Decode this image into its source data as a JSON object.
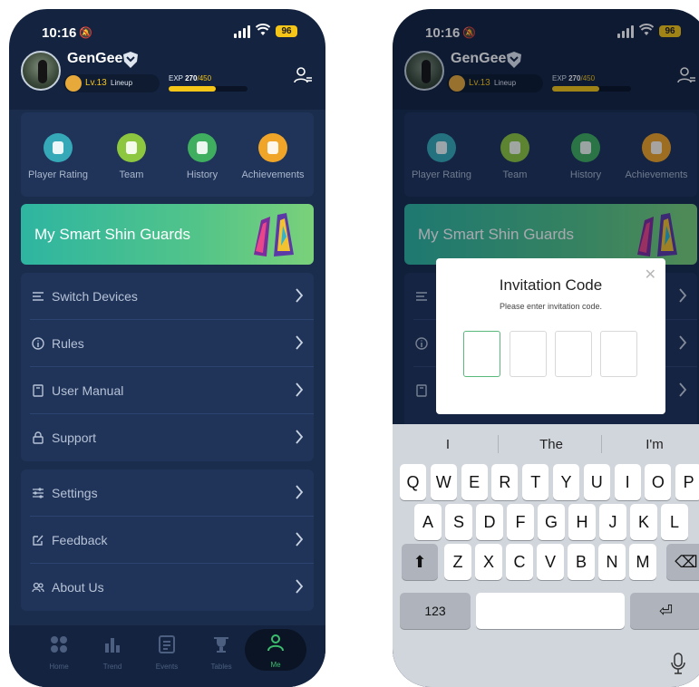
{
  "status": {
    "time": "10:16",
    "battery": "96"
  },
  "profile": {
    "username": "GenGee",
    "level": "Lv.13",
    "level_tag": "Lineup",
    "exp_label": "EXP",
    "exp_current": "270",
    "exp_max": "/450",
    "exp_fraction": 0.6
  },
  "quick_actions": [
    {
      "label": "Player Rating",
      "color": "#36a9b8"
    },
    {
      "label": "Team",
      "color": "#8dc63f"
    },
    {
      "label": "History",
      "color": "#3fae5f"
    },
    {
      "label": "Achievements",
      "color": "#f0a528"
    }
  ],
  "banner": {
    "title": "My Smart Shin Guards"
  },
  "menu_group_1": [
    {
      "label": "Switch Devices",
      "icon": "switch-icon"
    },
    {
      "label": "Rules",
      "icon": "info-icon"
    },
    {
      "label": "User Manual",
      "icon": "manual-icon"
    },
    {
      "label": "Support",
      "icon": "lock-icon"
    }
  ],
  "menu_group_2": [
    {
      "label": "Settings",
      "icon": "sliders-icon"
    },
    {
      "label": "Feedback",
      "icon": "edit-icon"
    },
    {
      "label": "About Us",
      "icon": "people-icon"
    }
  ],
  "tabs": [
    {
      "label": "Home"
    },
    {
      "label": "Trend"
    },
    {
      "label": "Events"
    },
    {
      "label": "Tables"
    },
    {
      "label": "Me",
      "active": true
    }
  ],
  "dialog": {
    "title": "Invitation Code",
    "subtitle": "Please enter invitation code.",
    "close": "✕",
    "code_length": 4
  },
  "keyboard": {
    "suggestions": [
      "I",
      "The",
      "I'm"
    ],
    "row1": [
      "Q",
      "W",
      "E",
      "R",
      "T",
      "Y",
      "U",
      "I",
      "O",
      "P"
    ],
    "row2": [
      "A",
      "S",
      "D",
      "F",
      "G",
      "H",
      "J",
      "K",
      "L"
    ],
    "row3": [
      "Z",
      "X",
      "C",
      "V",
      "B",
      "N",
      "M"
    ],
    "numbers_key": "123",
    "return_key": "⏎",
    "shift_key": "⬆",
    "delete_key": "⌫"
  },
  "colors": {
    "background": "#142440",
    "card": "#20345a",
    "accent": "#3bbf6e",
    "gold": "#f5c518"
  }
}
